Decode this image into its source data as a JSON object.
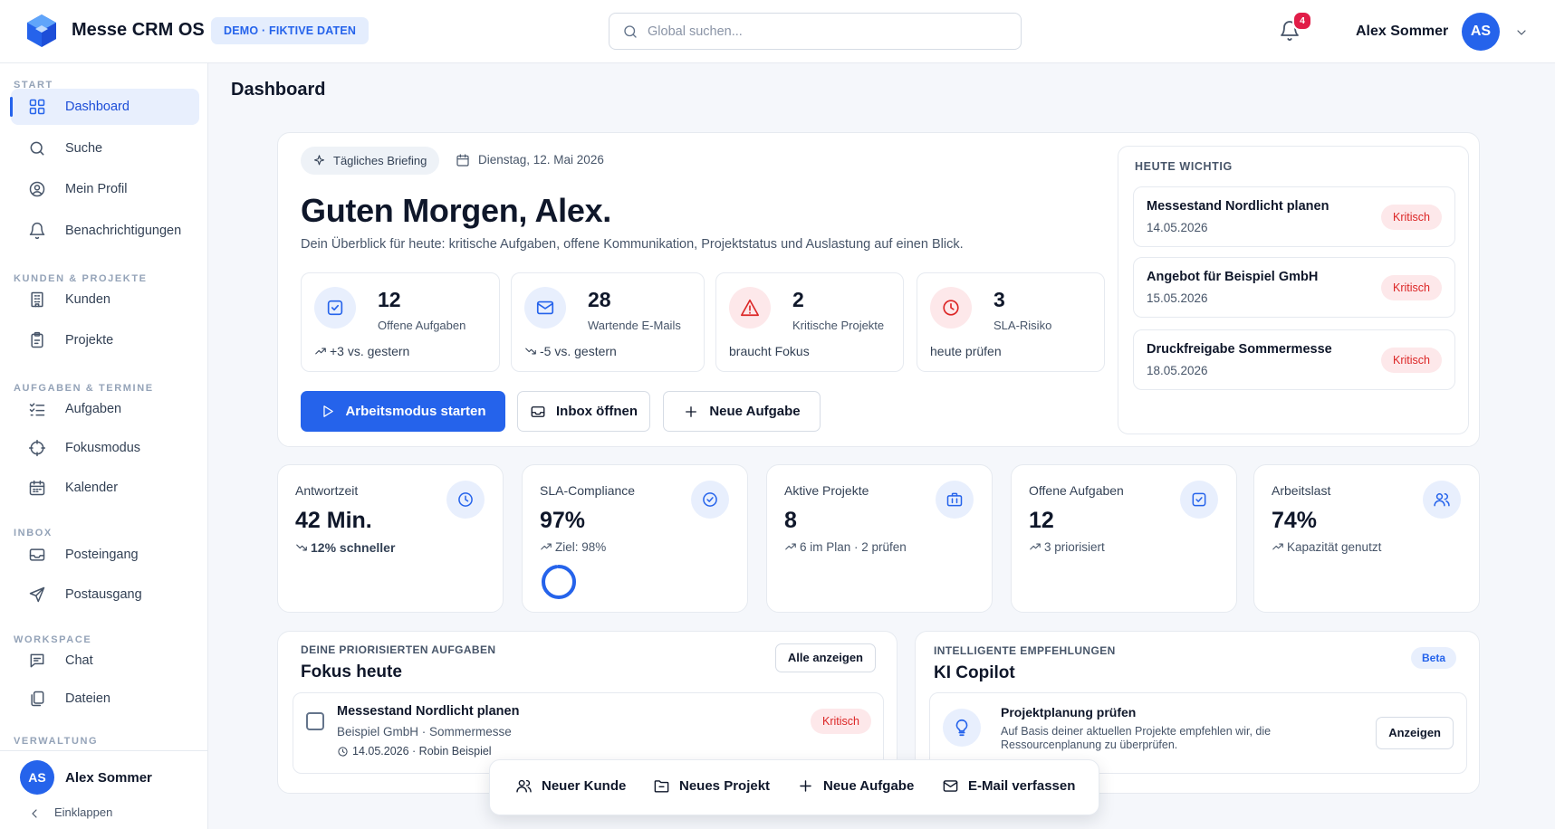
{
  "header": {
    "app_title": "Messe CRM OS",
    "demo_badge": "DEMO · FIKTIVE DATEN",
    "search_placeholder": "Global suchen...",
    "notification_count": "4",
    "user_name": "Alex Sommer",
    "user_initials": "AS"
  },
  "sidebar": {
    "sections": [
      "START",
      "KUNDEN & PROJEKTE",
      "AUFGABEN & TERMINE",
      "INBOX",
      "WORKSPACE",
      "VERWALTUNG"
    ],
    "items": [
      {
        "label": "Dashboard",
        "icon": "grid-icon",
        "active": true
      },
      {
        "label": "Suche",
        "icon": "search-icon"
      },
      {
        "label": "Mein Profil",
        "icon": "user-circle-icon"
      },
      {
        "label": "Benachrichtigungen",
        "icon": "bell-icon"
      },
      {
        "label": "Kunden",
        "icon": "building-icon"
      },
      {
        "label": "Projekte",
        "icon": "clipboard-icon"
      },
      {
        "label": "Aufgaben",
        "icon": "list-check-icon"
      },
      {
        "label": "Fokusmodus",
        "icon": "target-icon"
      },
      {
        "label": "Kalender",
        "icon": "calendar-icon"
      },
      {
        "label": "Posteingang",
        "icon": "inbox-icon"
      },
      {
        "label": "Postausgang",
        "icon": "send-icon"
      },
      {
        "label": "Chat",
        "icon": "chat-icon"
      },
      {
        "label": "Dateien",
        "icon": "files-icon"
      }
    ],
    "user_name": "Alex Sommer",
    "user_initials": "AS",
    "collapse_label": "Einklappen"
  },
  "page": {
    "title": "Dashboard"
  },
  "hero": {
    "chip": "Tägliches Briefing",
    "date": "Dienstag, 12. Mai 2026",
    "greeting": "Guten Morgen, Alex.",
    "subtitle": "Dein Überblick für heute: kritische Aufgaben, offene Kommunikation, Projektstatus und Auslastung auf einen Blick.",
    "stats": [
      {
        "value": "12",
        "label": "Offene Aufgaben",
        "footer": "+3 vs. gestern",
        "icon": "checkbox-icon",
        "trend": "up"
      },
      {
        "value": "28",
        "label": "Wartende E-Mails",
        "footer": "-5 vs. gestern",
        "icon": "mail-icon",
        "trend": "down"
      },
      {
        "value": "2",
        "label": "Kritische Projekte",
        "footer": "braucht Fokus",
        "icon": "alert-icon"
      },
      {
        "value": "3",
        "label": "SLA-Risiko",
        "footer": "heute prüfen",
        "icon": "clock-icon"
      }
    ],
    "buttons": {
      "start": "Arbeitsmodus starten",
      "inbox": "Inbox öffnen",
      "new_task": "Neue Aufgabe"
    }
  },
  "important": {
    "heading": "HEUTE WICHTIG",
    "items": [
      {
        "title": "Messestand Nordlicht planen",
        "date": "14.05.2026",
        "badge": "Kritisch"
      },
      {
        "title": "Angebot für Beispiel GmbH",
        "date": "15.05.2026",
        "badge": "Kritisch"
      },
      {
        "title": "Druckfreigabe Sommermesse",
        "date": "18.05.2026",
        "badge": "Kritisch"
      }
    ]
  },
  "metrics": [
    {
      "title": "Antwortzeit",
      "value": "42 Min.",
      "footer": "12% schneller",
      "icon": "clock-icon",
      "trend": "down"
    },
    {
      "title": "SLA-Compliance",
      "value": "97%",
      "footer": "Ziel: 98%",
      "icon": "check-circle-icon",
      "trend": "up",
      "progress": 0.97
    },
    {
      "title": "Aktive Projekte",
      "value": "8",
      "footer": "6 im Plan · 2 prüfen",
      "icon": "briefcase-icon",
      "trend": "up"
    },
    {
      "title": "Offene Aufgaben",
      "value": "12",
      "footer": "3 priorisiert",
      "icon": "checkbox-icon",
      "trend": "up"
    },
    {
      "title": "Arbeitslast",
      "value": "74%",
      "footer": "Kapazität genutzt",
      "icon": "users-icon",
      "trend": "up"
    }
  ],
  "focus": {
    "heading": "DEINE PRIORISIERTEN AUFGABEN",
    "title": "Fokus heute",
    "show_all": "Alle anzeigen",
    "task": {
      "title": "Messestand Nordlicht planen",
      "subtitle": "Beispiel GmbH · Sommermesse",
      "meta": "14.05.2026 · Robin Beispiel",
      "badge": "Kritisch"
    }
  },
  "copilot": {
    "heading": "INTELLIGENTE EMPFEHLUNGEN",
    "title": "KI Copilot",
    "badge": "Beta",
    "rec": {
      "title": "Projektplanung prüfen",
      "text": "Auf Basis deiner aktuellen Projekte empfehlen wir, die Ressourcenplanung zu überprüfen.",
      "button": "Anzeigen"
    }
  },
  "quick_actions": [
    "Neuer Kunde",
    "Neues Projekt",
    "Neue Aufgabe",
    "E-Mail verfassen"
  ],
  "colors": {
    "accent": "#2563eb",
    "critical": "#dc2626",
    "critical_bg": "#fde8ea"
  }
}
